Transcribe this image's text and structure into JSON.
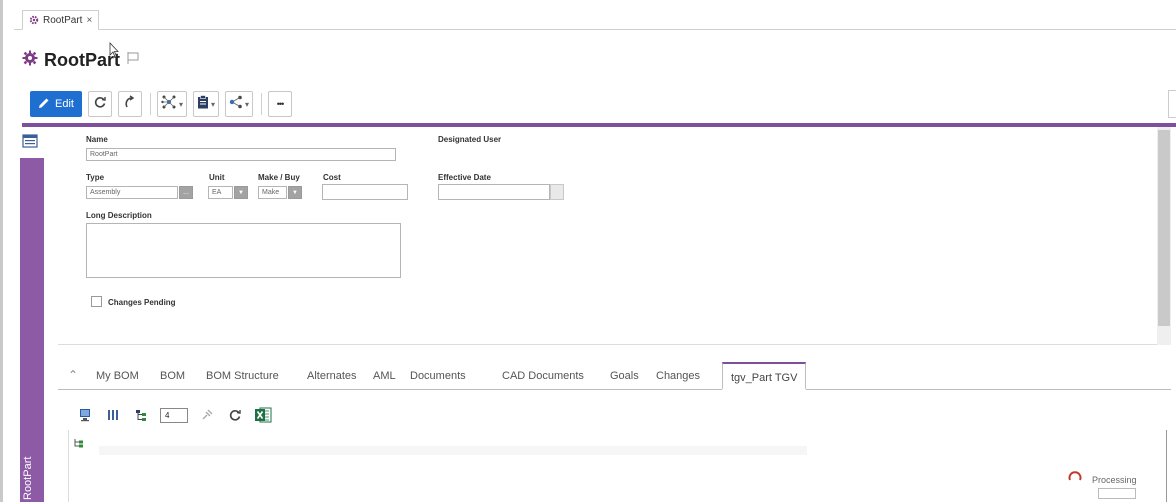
{
  "window": {
    "tab_title": "RootPart",
    "tab_close": "×"
  },
  "header": {
    "title": "RootPart"
  },
  "toolbar": {
    "edit_label": "Edit",
    "more_label": "•••",
    "accent": "#1f6fd1",
    "brand": "#7e4f9d"
  },
  "sidebar": {
    "label": "RootPart"
  },
  "form": {
    "name_label": "Name",
    "name_value": "RootPart",
    "designated_user_label": "Designated User",
    "type_label": "Type",
    "type_value": "Assembly",
    "unit_label": "Unit",
    "unit_value": "EA",
    "make_buy_label": "Make / Buy",
    "make_buy_value": "Make",
    "cost_label": "Cost",
    "effective_date_label": "Effective Date",
    "long_description_label": "Long Description",
    "changes_pending_label": "Changes Pending",
    "select_button_label": "..."
  },
  "relationships": {
    "tabs": [
      "My BOM",
      "BOM",
      "BOM Structure",
      "Alternates",
      "AML",
      "Documents",
      "CAD Documents",
      "Goals",
      "Changes",
      "tgv_Part TGV"
    ],
    "active_tab": "tgv_Part TGV"
  },
  "grid_toolbar": {
    "page_value": "4"
  },
  "status": {
    "processing_label": "Processing"
  }
}
